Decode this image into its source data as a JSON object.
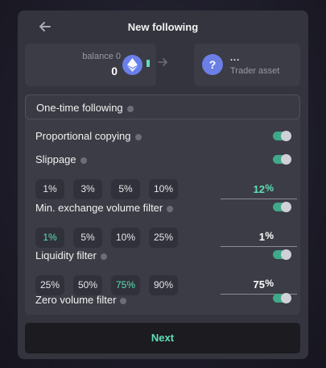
{
  "header": {
    "title": "New following",
    "back_icon": "arrow-left-icon"
  },
  "balance": {
    "label": "balance 0",
    "value": "0",
    "asset_icon": "ethereum-icon"
  },
  "trader": {
    "name": "...",
    "label": "Trader asset",
    "icon": "question-icon",
    "icon_glyph": "?"
  },
  "settings": {
    "one_time_label": "One-time following",
    "proportional": {
      "label": "Proportional copying",
      "enabled": true
    },
    "slippage": {
      "label": "Slippage",
      "enabled": true,
      "options": [
        "1%",
        "3%",
        "5%",
        "10%"
      ],
      "value": "12",
      "unit": "%"
    },
    "min_volume": {
      "label": "Min. exchange volume filter",
      "enabled": true,
      "options": [
        "1%",
        "5%",
        "10%",
        "25%"
      ],
      "selected": "1%",
      "value": "1",
      "unit": "%"
    },
    "liquidity": {
      "label": "Liquidity filter",
      "enabled": true,
      "options": [
        "25%",
        "50%",
        "75%",
        "90%"
      ],
      "selected": "75%",
      "value": "75",
      "unit": "%"
    },
    "zero_volume": {
      "label": "Zero volume filter",
      "enabled": true
    }
  },
  "footer": {
    "next_label": "Next"
  },
  "colors": {
    "accent": "#5ee0b6",
    "toggle_on": "#3fa88b",
    "panel": "#33343d",
    "eth": "#6a7fe8"
  }
}
